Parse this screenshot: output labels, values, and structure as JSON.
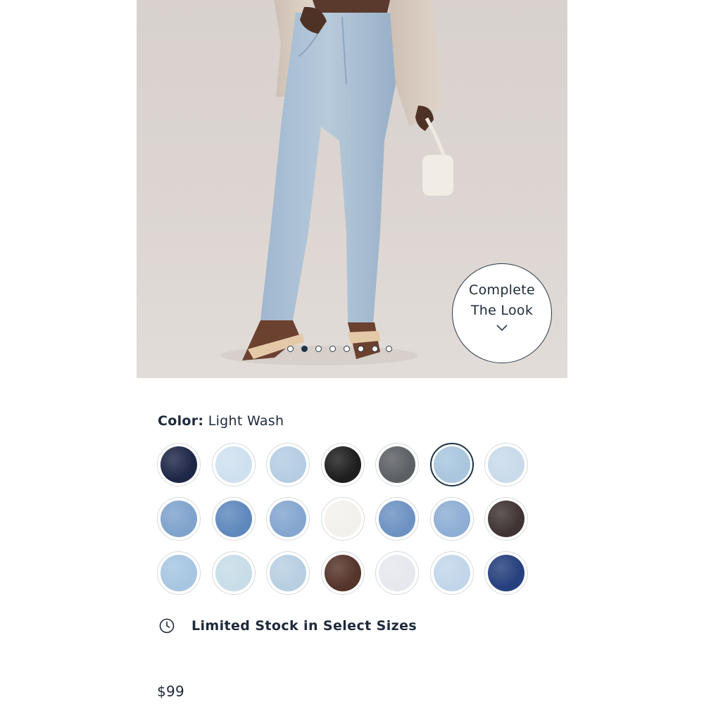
{
  "product_image": {
    "description_icon": "product-photo",
    "carousel_dots": {
      "count": 8,
      "active_index": 1
    },
    "complete_the_look": {
      "line1": "Complete",
      "line2": "The Look",
      "icon": "chevron-down-icon"
    }
  },
  "color": {
    "label": "Color:",
    "value": "Light Wash",
    "selected_index": 5,
    "swatches": [
      "#1f2748",
      "#cfe0ef",
      "#b5cde3",
      "#1e1e1e",
      "#5c5f64",
      "#a9c6de",
      "#c9daea",
      "#7fa3cc",
      "#5f88bd",
      "#84a6cf",
      "#f3f1ec",
      "#6d92c2",
      "#8eaed4",
      "#3f3433",
      "#a7c6e2",
      "#c7dde8",
      "#b8cfe2",
      "#55342a",
      "#e6e8ee",
      "#c2d6ea",
      "#263f7d"
    ]
  },
  "stock": {
    "icon": "clock-icon",
    "text": "Limited Stock in Select Sizes"
  },
  "price": "$99"
}
